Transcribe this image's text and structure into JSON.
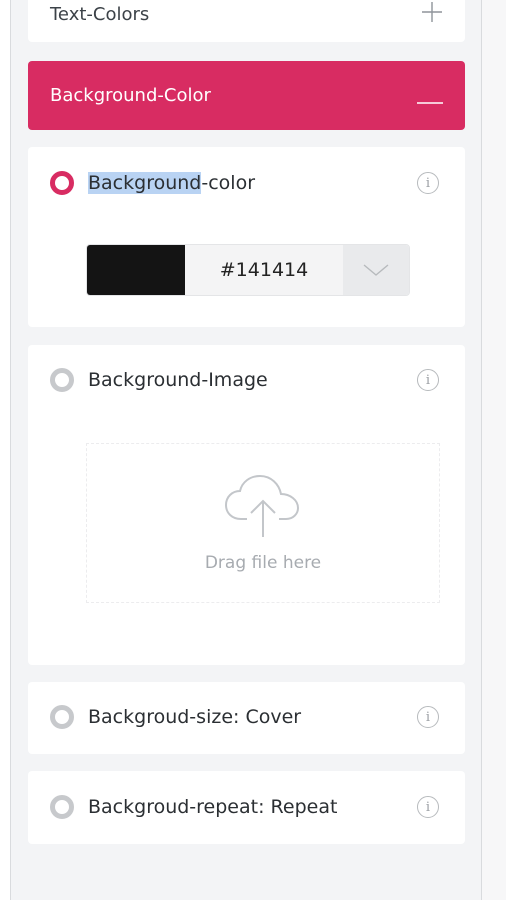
{
  "accordions": {
    "text_colors": {
      "title": "Text-Colors",
      "toggle": "+"
    },
    "background_color": {
      "title": "Background-Color",
      "toggle": "—"
    }
  },
  "options": [
    {
      "label_highlight": "Background",
      "label_rest": "-color",
      "selected": true,
      "info": "i"
    },
    {
      "label": "Background-Image",
      "selected": false,
      "info": "i"
    },
    {
      "label": "Backgroud-size: Cover",
      "selected": false,
      "info": "i"
    },
    {
      "label": "Backgroud-repeat: Repeat",
      "selected": false,
      "info": "i"
    }
  ],
  "color_picker": {
    "hex_value": "#141414",
    "swatch_color": "#141414"
  },
  "upload": {
    "text": "Drag file here",
    "icon": "cloud-upload-icon"
  },
  "colors": {
    "accent": "#d82c62",
    "panel_bg": "#f3f4f6"
  }
}
